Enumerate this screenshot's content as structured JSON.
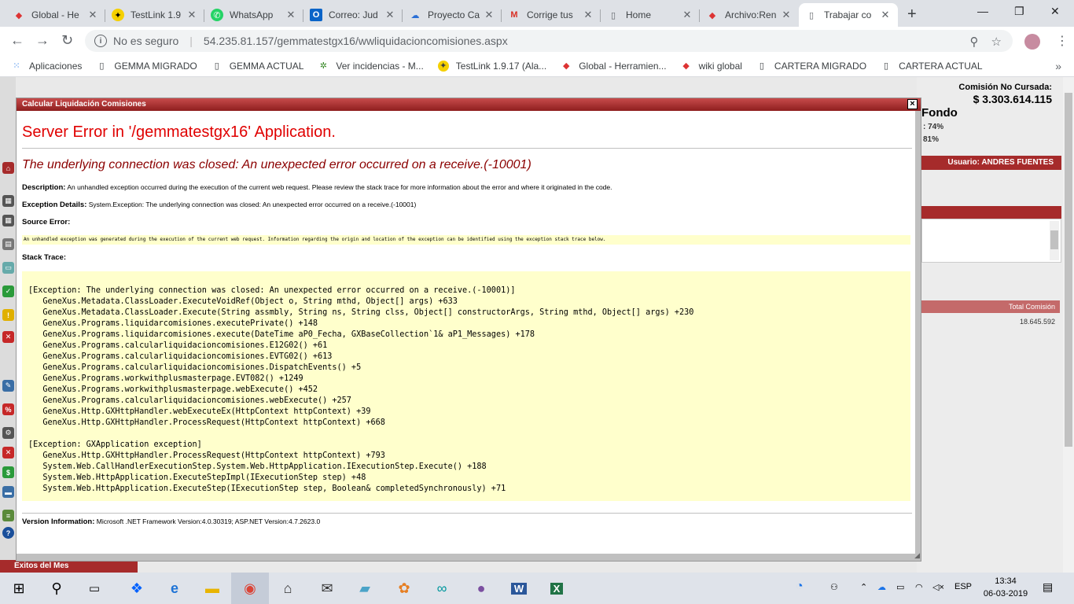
{
  "browser": {
    "tabs": [
      {
        "label": "Global - He",
        "icon": "globe-icon"
      },
      {
        "label": "TestLink 1.9",
        "icon": "testlink-icon"
      },
      {
        "label": "WhatsApp",
        "icon": "whatsapp-icon"
      },
      {
        "label": "Correo: Jud",
        "icon": "outlook-icon"
      },
      {
        "label": "Proyecto Ca",
        "icon": "azure-icon"
      },
      {
        "label": "Corrige tus",
        "icon": "gmail-icon"
      },
      {
        "label": "Home",
        "icon": "page-icon"
      },
      {
        "label": "Archivo:Ren",
        "icon": "wiki-icon"
      },
      {
        "label": "Trabajar co",
        "icon": "page-icon"
      }
    ],
    "security_label": "No es seguro",
    "url": "54.235.81.157/gemmatestgx16/wwliquidacioncomisiones.aspx",
    "bookmarks": [
      {
        "label": "Aplicaciones",
        "icon": "apps-grid-icon"
      },
      {
        "label": "GEMMA MIGRADO",
        "icon": "page-icon"
      },
      {
        "label": "GEMMA ACTUAL",
        "icon": "page-icon"
      },
      {
        "label": "Ver incidencias - M...",
        "icon": "bug-icon"
      },
      {
        "label": "TestLink 1.9.17 (Ala...",
        "icon": "testlink-icon"
      },
      {
        "label": "Global - Herramien...",
        "icon": "globe-icon"
      },
      {
        "label": "wiki global",
        "icon": "wiki-icon"
      },
      {
        "label": "CARTERA MIGRADO",
        "icon": "page-icon"
      },
      {
        "label": "CARTERA ACTUAL",
        "icon": "page-icon"
      }
    ]
  },
  "app": {
    "comision_label": "Comisión No Cursada:",
    "comision_value": "$ 3.303.614.115",
    "fondo_label": "Fondo",
    "pct1": ": 74%",
    "pct2": "81%",
    "usuario": "Usuario:  ANDRES FUENTES",
    "total_header": "Total Comisión",
    "total_value": "18.645.592",
    "exitos_label": "Exitos del Mes"
  },
  "dialog": {
    "title": "Calcular Liquidación Comisiones",
    "close": "×",
    "heading": "Server Error in '/gemmatestgx16' Application.",
    "subheading": "The underlying connection was closed: An unexpected error occurred on a receive.(-10001)",
    "description_label": "Description:",
    "description": "An unhandled exception occurred during the execution of the current web request. Please review the stack trace for more information about the error and where it originated in the code.",
    "exception_label": "Exception Details:",
    "exception": "System.Exception: The underlying connection was closed: An unexpected error occurred on a receive.(-10001)",
    "source_label": "Source Error:",
    "source_text": "An unhandled exception was generated during the execution of the current web request. Information regarding the origin and location of the exception can be identified using the exception stack trace below.",
    "stack_label": "Stack Trace:",
    "stack_block1": [
      "[Exception: The underlying connection was closed: An unexpected error occurred on a receive.(-10001)]",
      "   GeneXus.Metadata.ClassLoader.ExecuteVoidRef(Object o, String mthd, Object[] args) +633",
      "   GeneXus.Metadata.ClassLoader.Execute(String assmbly, String ns, String clss, Object[] constructorArgs, String mthd, Object[] args) +230",
      "   GeneXus.Programs.liquidarcomisiones.executePrivate() +148",
      "   GeneXus.Programs.liquidarcomisiones.execute(DateTime aP0_Fecha, GXBaseCollection`1& aP1_Messages) +178",
      "   GeneXus.Programs.calcularliquidacioncomisiones.E12G02() +61",
      "   GeneXus.Programs.calcularliquidacioncomisiones.EVTG02() +613",
      "   GeneXus.Programs.calcularliquidacioncomisiones.DispatchEvents() +5",
      "   GeneXus.Programs.workwithplusmasterpage.EVT082() +1249",
      "   GeneXus.Programs.workwithplusmasterpage.webExecute() +452",
      "   GeneXus.Programs.calcularliquidacioncomisiones.webExecute() +257",
      "   GeneXus.Http.GXHttpHandler.webExecuteEx(HttpContext httpContext) +39",
      "   GeneXus.Http.GXHttpHandler.ProcessRequest(HttpContext httpContext) +668"
    ],
    "stack_block2": [
      "[Exception: GXApplication exception]",
      "   GeneXus.Http.GXHttpHandler.ProcessRequest(HttpContext httpContext) +793",
      "   System.Web.CallHandlerExecutionStep.System.Web.HttpApplication.IExecutionStep.Execute() +188",
      "   System.Web.HttpApplication.ExecuteStepImpl(IExecutionStep step) +48",
      "   System.Web.HttpApplication.ExecuteStep(IExecutionStep step, Boolean& completedSynchronously) +71"
    ],
    "version_label": "Version Information:",
    "version": "Microsoft .NET Framework Version:4.0.30319; ASP.NET Version:4.7.2623.0"
  },
  "taskbar": {
    "language": "ESP",
    "time": "13:34",
    "date": "06-03-2019"
  }
}
